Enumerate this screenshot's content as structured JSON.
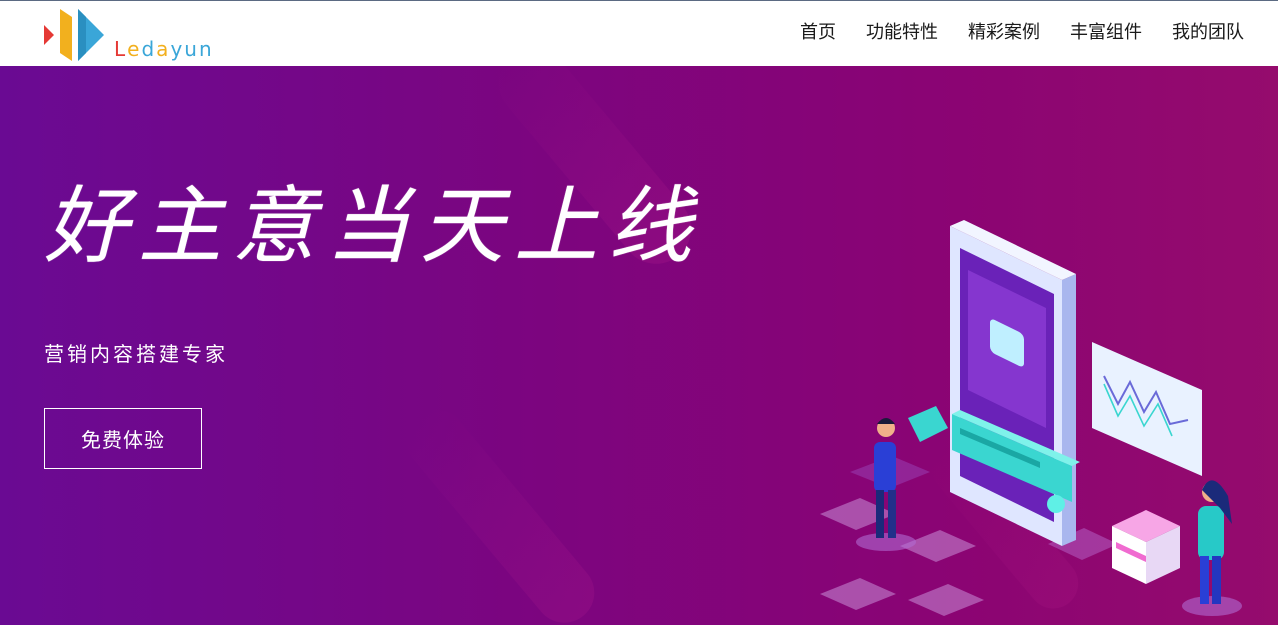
{
  "brand": {
    "name_letters": [
      {
        "ch": "L",
        "color": "#e53935"
      },
      {
        "ch": "e",
        "color": "#f2b01e"
      },
      {
        "ch": "d",
        "color": "#3aa6d8"
      },
      {
        "ch": "a",
        "color": "#f2b01e"
      },
      {
        "ch": "y",
        "color": "#3aa6d8"
      },
      {
        "ch": "u",
        "color": "#3aa6d8"
      },
      {
        "ch": "n",
        "color": "#3aa6d8"
      }
    ]
  },
  "nav": {
    "items": [
      {
        "label": "首页"
      },
      {
        "label": "功能特性"
      },
      {
        "label": "精彩案例"
      },
      {
        "label": "丰富组件"
      },
      {
        "label": "我的团队"
      }
    ]
  },
  "hero": {
    "headline": "好主意当天上线",
    "subtitle": "营销内容搭建专家",
    "cta_label": "免费体验"
  },
  "colors": {
    "hero_start": "#6a0a93",
    "hero_end": "#950b6d",
    "accent_cyan": "#3ad6d0",
    "accent_pink": "#e83fb0"
  }
}
